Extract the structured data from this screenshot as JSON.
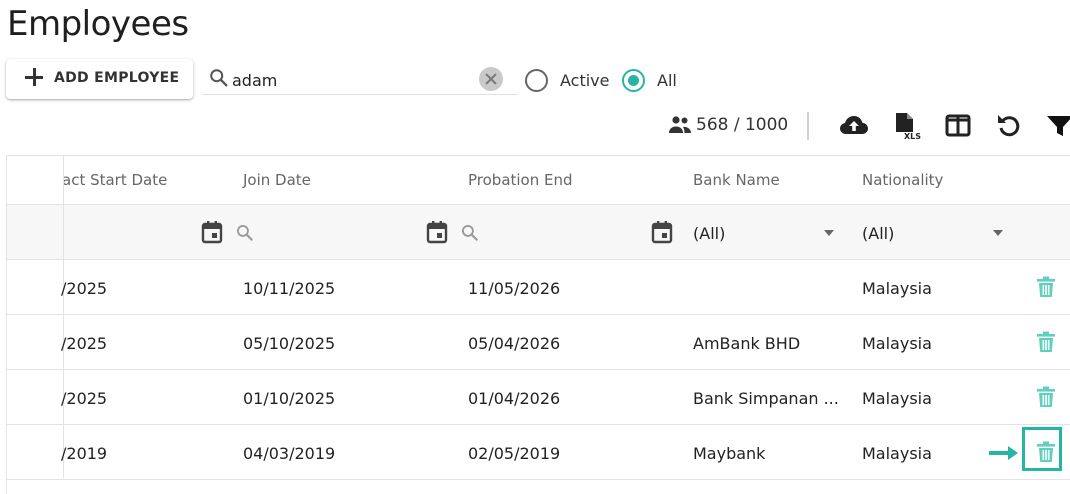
{
  "page": {
    "title": "Employees"
  },
  "toolbar": {
    "add_label": "ADD EMPLOYEE",
    "search_value": "adam",
    "radio_active": "Active",
    "radio_all": "All",
    "selected_filter": "All",
    "count": "568 / 1000",
    "icons": [
      "upload-cloud-icon",
      "export-xls-icon",
      "columns-icon",
      "refresh-icon",
      "filter-icon"
    ]
  },
  "table": {
    "columns": [
      "act Start Date",
      "Join Date",
      "Probation End",
      "Bank Name",
      "Nationality"
    ],
    "filters": {
      "bank": "(All)",
      "nationality": "(All)"
    },
    "rows": [
      {
        "contract_start": "/2025",
        "join_date": "10/11/2025",
        "probation_end": "11/05/2026",
        "bank": "",
        "nationality": "Malaysia"
      },
      {
        "contract_start": "/2025",
        "join_date": "05/10/2025",
        "probation_end": "05/04/2026",
        "bank": "AmBank BHD",
        "nationality": "Malaysia"
      },
      {
        "contract_start": "/2025",
        "join_date": "01/10/2025",
        "probation_end": "01/04/2026",
        "bank": "Bank Simpanan ...",
        "nationality": "Malaysia"
      },
      {
        "contract_start": "/2019",
        "join_date": "04/03/2019",
        "probation_end": "02/05/2019",
        "bank": "Maybank",
        "nationality": "Malaysia"
      }
    ]
  },
  "colors": {
    "accent": "#26b5a4",
    "trash": "#5fd0bd",
    "text": "#222222",
    "muted": "#666666"
  }
}
